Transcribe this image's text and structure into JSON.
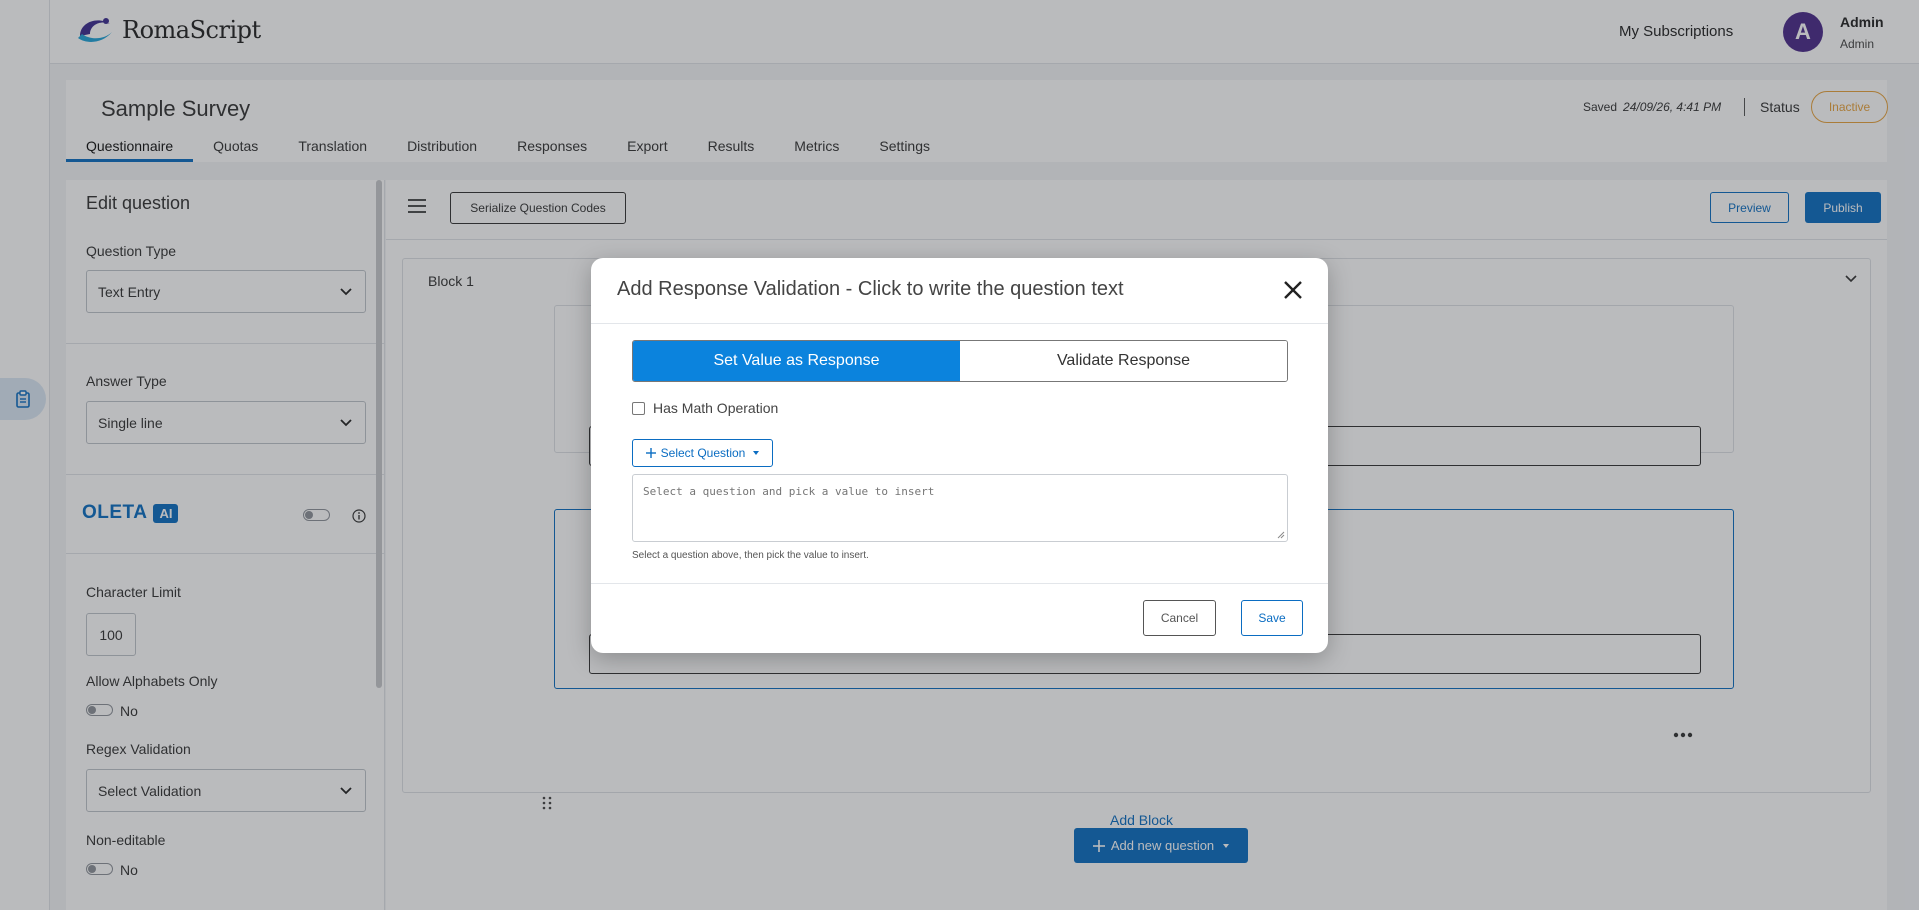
{
  "app": {
    "logo_text": "RomaScript"
  },
  "header": {
    "subscriptions": "My Subscriptions",
    "avatar_letter": "A",
    "user_name": "Admin",
    "user_role": "Admin"
  },
  "survey": {
    "title": "Sample Survey",
    "saved_label": "Saved",
    "saved_time": "24/09/26, 4:41 PM",
    "status_label": "Status",
    "status_value": "Inactive",
    "tabs": [
      "Questionnaire",
      "Quotas",
      "Translation",
      "Distribution",
      "Responses",
      "Export",
      "Results",
      "Metrics",
      "Settings"
    ],
    "active_tab": "Questionnaire"
  },
  "edit_panel": {
    "title": "Edit question",
    "question_type_label": "Question Type",
    "question_type_value": "Text Entry",
    "answer_type_label": "Answer Type",
    "answer_type_value": "Single line",
    "oleta": "OLETA",
    "ai": "AI",
    "char_limit_label": "Character Limit",
    "char_limit_value": "100",
    "alphabets_label": "Allow Alphabets Only",
    "alphabets_value": "No",
    "regex_label": "Regex Validation",
    "regex_value": "Select Validation",
    "noneditable_label": "Non-editable",
    "noneditable_value": "No"
  },
  "toolbar": {
    "serialize": "Serialize Question Codes",
    "preview": "Preview",
    "publish": "Publish"
  },
  "block": {
    "title": "Block 1",
    "add_question": "Add new question",
    "add_block": "Add Block"
  },
  "modal": {
    "title": "Add Response Validation - Click to write the question text",
    "tabs": [
      "Set Value as Response",
      "Validate Response"
    ],
    "has_math": "Has Math Operation",
    "select_question": "Select Question",
    "textarea_placeholder": "Select a question and pick a value to insert",
    "hint": "Select a question above, then pick the value to insert.",
    "cancel": "Cancel",
    "save": "Save"
  },
  "colors": {
    "accent": "#0b6dc2",
    "tab_active": "#0b83dd",
    "status": "#e8a33d",
    "avatar": "#4b2a8a"
  }
}
